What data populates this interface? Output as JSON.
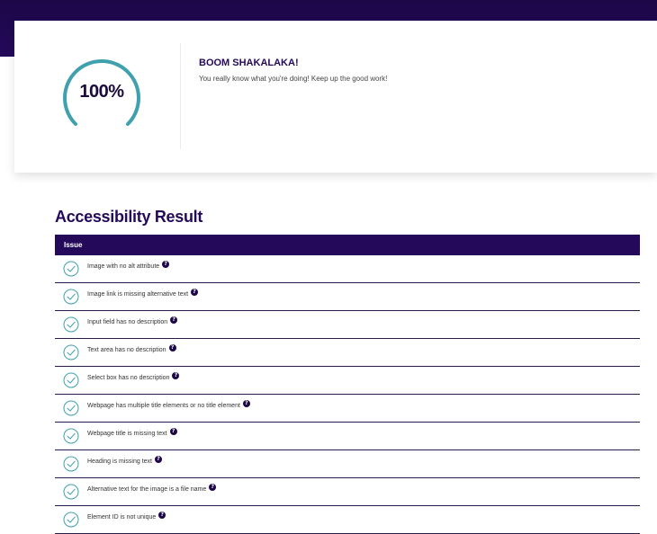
{
  "score": {
    "value": "100%",
    "percent": 100,
    "ring_color": "#3ea1ad"
  },
  "message": {
    "title": "BOOM SHAKALAKA!",
    "subtitle": "You really know what you're doing! Keep up the good work!"
  },
  "results": {
    "title": "Accessibility Result",
    "column_header": "Issue",
    "help_glyph": "?",
    "check_color": "#3ea1ad",
    "rows": [
      {
        "label": "Image with no alt attribute",
        "icon": "check-circle-icon"
      },
      {
        "label": "Image link is missing alternative text",
        "icon": "check-circle-icon"
      },
      {
        "label": "Input field has no description",
        "icon": "check-circle-icon"
      },
      {
        "label": "Text area has no description",
        "icon": "check-circle-icon"
      },
      {
        "label": "Select box has no description",
        "icon": "check-circle-icon"
      },
      {
        "label": "Webpage has multiple title elements or no title element",
        "icon": "check-circle-icon"
      },
      {
        "label": "Webpage title is missing text",
        "icon": "check-circle-icon"
      },
      {
        "label": "Heading is missing text",
        "icon": "check-circle-icon"
      },
      {
        "label": "Alternative text for the image is a file name",
        "icon": "check-circle-icon"
      },
      {
        "label": "Element ID is not unique",
        "icon": "check-circle-icon"
      }
    ]
  }
}
